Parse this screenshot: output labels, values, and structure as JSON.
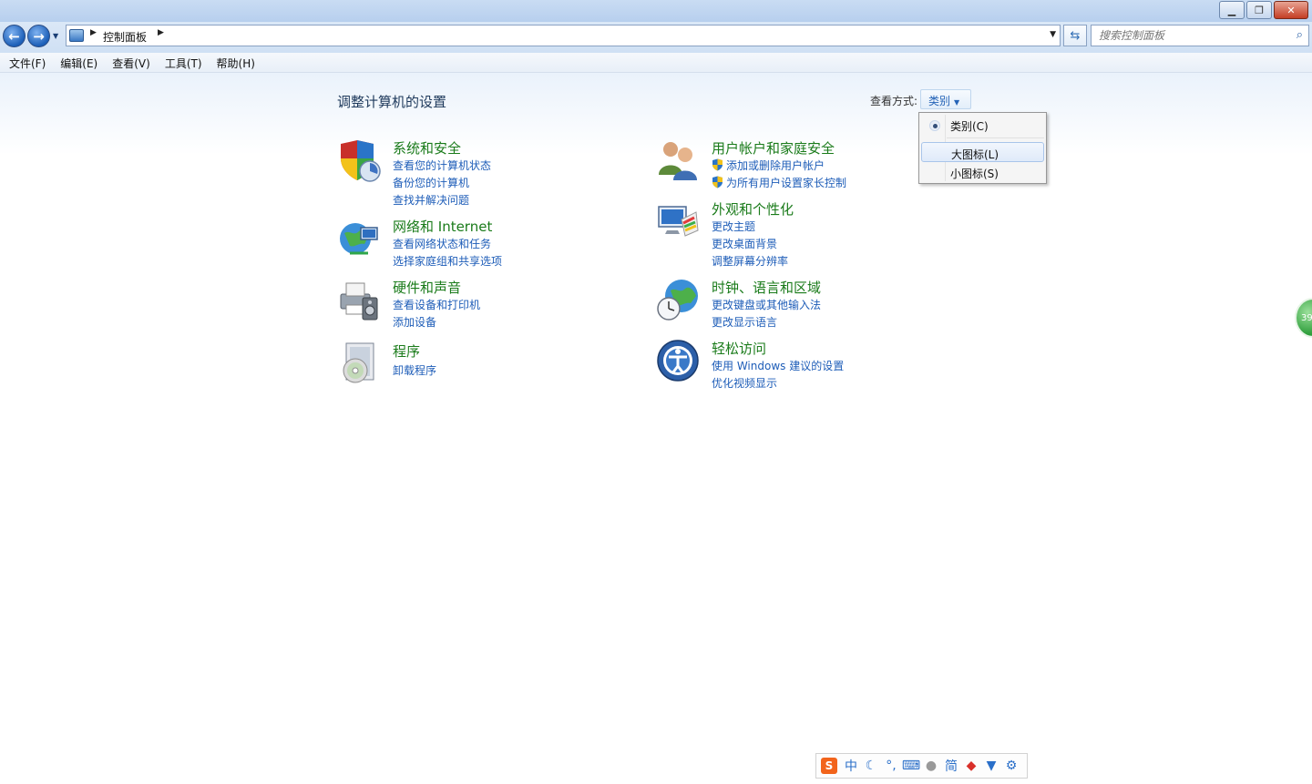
{
  "nav": {
    "address_path": "控制面板",
    "search_placeholder": "搜索控制面板"
  },
  "menu": {
    "items": [
      "文件(F)",
      "编辑(E)",
      "查看(V)",
      "工具(T)",
      "帮助(H)"
    ]
  },
  "main": {
    "title": "调整计算机的设置",
    "view_by_label": "查看方式:",
    "view_by_value": "类别"
  },
  "view_menu": {
    "items": [
      "类别(C)",
      "大图标(L)",
      "小图标(S)"
    ],
    "selected": "类别(C)",
    "highlighted": "大图标(L)"
  },
  "categories": [
    {
      "title": "系统和安全",
      "links": [
        "查看您的计算机状态",
        "备份您的计算机",
        "查找并解决问题"
      ]
    },
    {
      "title": "网络和 Internet",
      "links": [
        "查看网络状态和任务",
        "选择家庭组和共享选项"
      ]
    },
    {
      "title": "硬件和声音",
      "links": [
        "查看设备和打印机",
        "添加设备"
      ]
    },
    {
      "title": "程序",
      "links": [
        "卸载程序"
      ]
    },
    {
      "title": "用户帐户和家庭安全",
      "links": [
        "添加或删除用户帐户",
        "为所有用户设置家长控制"
      ]
    },
    {
      "title": "外观和个性化",
      "links": [
        "更改主题",
        "更改桌面背景",
        "调整屏幕分辨率"
      ]
    },
    {
      "title": "时钟、语言和区域",
      "links": [
        "更改键盘或其他输入法",
        "更改显示语言"
      ]
    },
    {
      "title": "轻松访问",
      "links": [
        "使用 Windows 建议的设置",
        "优化视频显示"
      ]
    }
  ],
  "side_widget": {
    "text": "39"
  },
  "ime": {
    "mode": "中",
    "script": "简"
  },
  "colors": {
    "category_title": "#1a7b1a",
    "link": "#1e5db8",
    "page_title": "#1e395b"
  }
}
